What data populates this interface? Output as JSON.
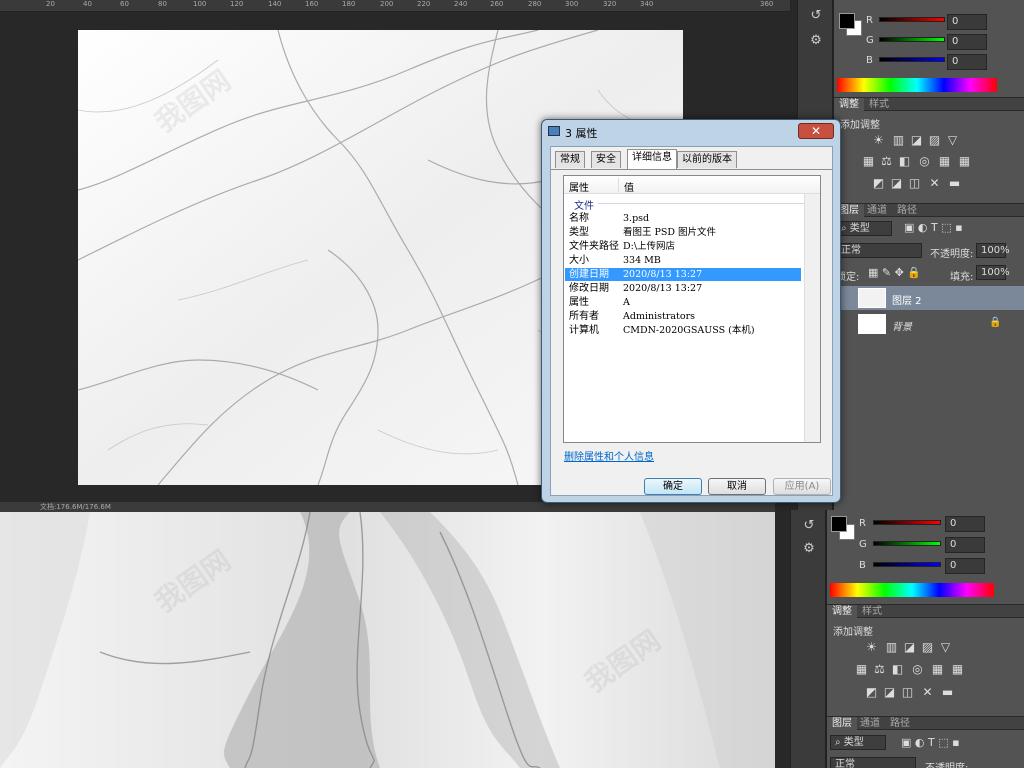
{
  "ruler": {
    "ticks": [
      "20",
      "40",
      "60",
      "80",
      "100",
      "120",
      "140",
      "160",
      "180",
      "200",
      "220",
      "240",
      "260",
      "280",
      "300",
      "320",
      "340",
      "360"
    ]
  },
  "doc_info": {
    "text": "文档:176.6M/176.6M"
  },
  "color_panel": {
    "r_label": "R",
    "g_label": "G",
    "b_label": "B",
    "r_value": "0",
    "g_value": "0",
    "b_value": "0",
    "foreground": "#000000",
    "background": "#ffffff"
  },
  "adjust_panel": {
    "tab_adjust": "调整",
    "tab_styles": "样式",
    "heading": "添加调整",
    "icons_row1": [
      "☀",
      "▥",
      "◪",
      "▨",
      "▽"
    ],
    "icons_row2": [
      "▦",
      "⚖",
      "◧",
      "◎",
      "▦"
    ],
    "icons_row3": [
      "◩",
      "◪",
      "◫",
      "✕",
      "▬"
    ]
  },
  "layers_panel_top": {
    "tab_layers": "图层",
    "tab_channels": "通道",
    "tab_paths": "路径",
    "kind_label": "类型",
    "blend_mode": "正常",
    "opacity_label": "不透明度:",
    "opacity_value": "100%",
    "lock_label": "锁定:",
    "fill_label": "填充:",
    "fill_value": "100%",
    "layers": [
      {
        "name": "图层 2"
      },
      {
        "name": "背景"
      }
    ]
  },
  "layers_panel_bottom": {
    "tab_layers": "图层",
    "tab_channels": "通道",
    "tab_paths": "路径",
    "kind_label": "类型",
    "blend_mode": "正常",
    "opacity_label": "不透明度:"
  },
  "dialog": {
    "title": "3 属性",
    "close": "✕",
    "tabs": [
      "常规",
      "安全",
      "详细信息",
      "以前的版本"
    ],
    "col_property": "属性",
    "col_value": "值",
    "section": "文件",
    "rows": [
      {
        "k": "名称",
        "v": "3.psd"
      },
      {
        "k": "类型",
        "v": "看图王 PSD 图片文件"
      },
      {
        "k": "文件夹路径",
        "v": "D:\\上传网店"
      },
      {
        "k": "大小",
        "v": "334 MB"
      },
      {
        "k": "创建日期",
        "v": "2020/8/13 13:27"
      },
      {
        "k": "修改日期",
        "v": "2020/8/13 13:27"
      },
      {
        "k": "属性",
        "v": "A"
      },
      {
        "k": "所有者",
        "v": "Administrators"
      },
      {
        "k": "计算机",
        "v": "CMDN-2020GSAUSS (本机)"
      }
    ],
    "remove_link": "删除属性和个人信息",
    "ok": "确定",
    "cancel": "取消",
    "apply": "应用(A)"
  },
  "colors": {
    "selection": "#3399ff",
    "panel": "#535353"
  }
}
